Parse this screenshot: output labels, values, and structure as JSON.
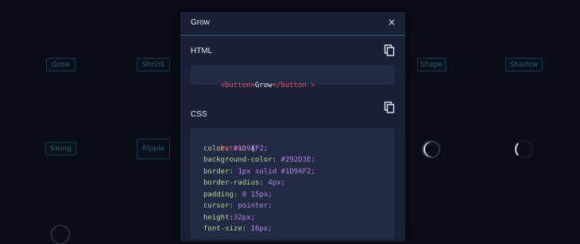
{
  "background": {
    "buttons": [
      {
        "label": "Grow"
      },
      {
        "label": "Shrink"
      },
      {
        "label": "Shape"
      },
      {
        "label": "Shadow"
      },
      {
        "label": "Swing"
      },
      {
        "label": "Ripple"
      }
    ]
  },
  "modal": {
    "title": "Grow",
    "close_glyph": "×",
    "html_label": "HTML",
    "css_label": "CSS",
    "html_code": {
      "open_tag": "<button>",
      "text": "Grow",
      "close_tag": "</button >"
    },
    "css_code": {
      "selector": "button",
      "open_brace": " {",
      "lines": [
        {
          "prop": "color:",
          "val": " #1D9AF2;"
        },
        {
          "prop": "background-color:",
          "val": " #292D3E;"
        },
        {
          "prop": "border:",
          "val": " 1px solid #1D9AF2;"
        },
        {
          "prop": "border-radius:",
          "val": " 4px;"
        },
        {
          "prop": "padding:",
          "val": " 0 15px;"
        },
        {
          "prop": "cursor:",
          "val": " pointer;"
        },
        {
          "prop": "height:",
          "val": "32px;"
        },
        {
          "prop": "font-size:",
          "val": " 16px;"
        }
      ]
    }
  },
  "colors": {
    "accent": "#1D9AF2",
    "modal_bg": "#1a2036",
    "code_bg": "#232a44",
    "tag": "#e8566b",
    "property": "#b9d19a",
    "value": "#b487e6"
  }
}
